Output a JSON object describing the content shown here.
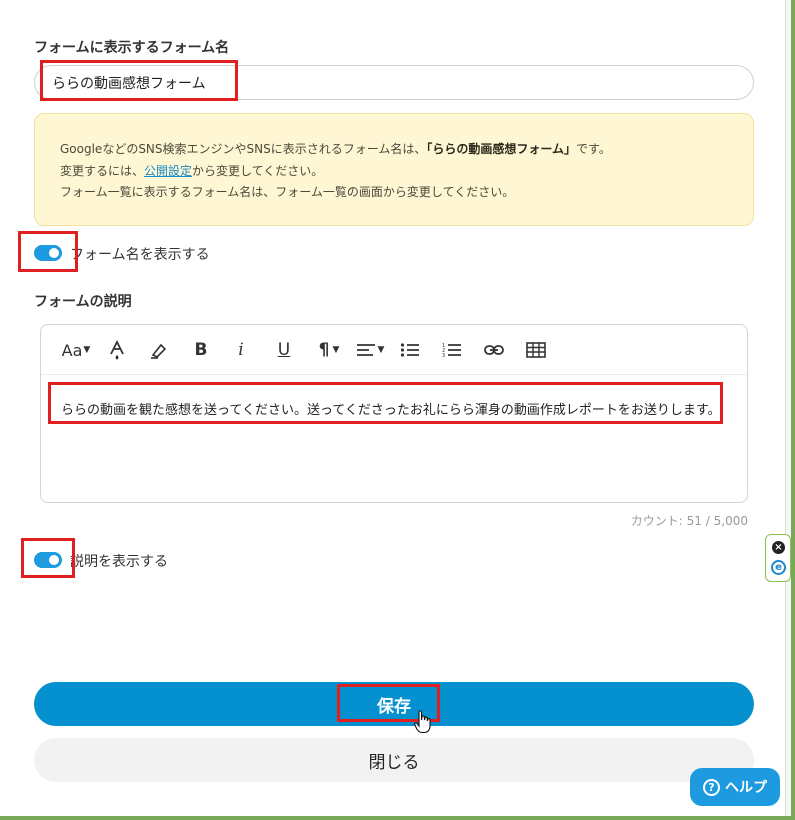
{
  "form_name": {
    "label": "フォームに表示するフォーム名",
    "value": "ららの動画感想フォーム"
  },
  "notice": {
    "line1_prefix": "GoogleなどのSNS検索エンジンやSNSに表示されるフォーム名は、",
    "line1_strong": "「ららの動画感想フォーム」",
    "line1_suffix": "です。",
    "line2_prefix": "変更するには、",
    "line2_link": "公開設定",
    "line2_suffix": "から変更してください。",
    "line3": "フォーム一覧に表示するフォーム名は、フォーム一覧の画面から変更してください。"
  },
  "show_form_name": {
    "label": "フォーム名を表示する",
    "checked": true
  },
  "description": {
    "label": "フォームの説明",
    "text": "ららの動画を観た感想を送ってください。送ってくださったお礼にらら渾身の動画作成レポートをお送りします。",
    "count_label": "カウント:",
    "count_value": "51",
    "count_sep": "/",
    "count_max": "5,000"
  },
  "toolbar": {
    "font_size": "Aa",
    "bold": "B",
    "italic": "i",
    "underline": "U",
    "paragraph": "¶"
  },
  "show_description": {
    "label": "説明を表示する",
    "checked": true
  },
  "buttons": {
    "save": "保存",
    "close": "閉じる",
    "help": "ヘルプ",
    "help_icon": "?"
  },
  "side_widget": {
    "close_glyph": "×",
    "ext_glyph": "e"
  },
  "colors": {
    "primary": "#0590cf",
    "toggle": "#1e9be0",
    "notice_bg": "#fff6d4",
    "highlight": "#e02020"
  }
}
